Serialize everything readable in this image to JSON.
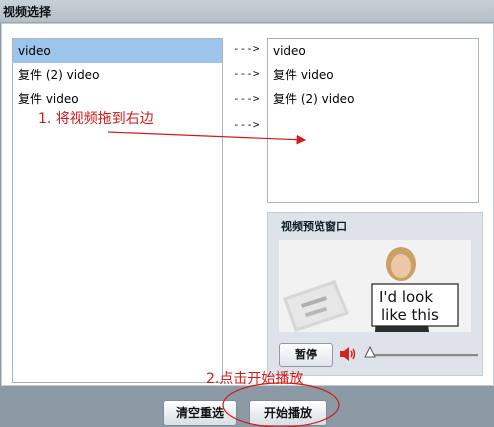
{
  "window": {
    "title": "视频选择"
  },
  "left_list": {
    "items": [
      {
        "label": "video",
        "selected": true
      },
      {
        "label": "复件 (2) video",
        "selected": false
      },
      {
        "label": "复件 video",
        "selected": false
      }
    ]
  },
  "arrows": [
    "--->",
    "--->",
    "--->",
    "--->"
  ],
  "right_list": {
    "items": [
      {
        "label": "video"
      },
      {
        "label": "复件 video"
      },
      {
        "label": "复件 (2) video"
      }
    ]
  },
  "preview": {
    "title": "视频预览窗口",
    "sign_line1": "I'd look",
    "sign_line2": "like this",
    "pause_label": "暂停",
    "volume_level": 0
  },
  "annotations": {
    "step1": "1. 将视频拖到右边",
    "step2": "2.点击开始播放",
    "color": "#d31a1a"
  },
  "buttons": {
    "clear_label": "清空重选",
    "play_label": "开始播放"
  }
}
